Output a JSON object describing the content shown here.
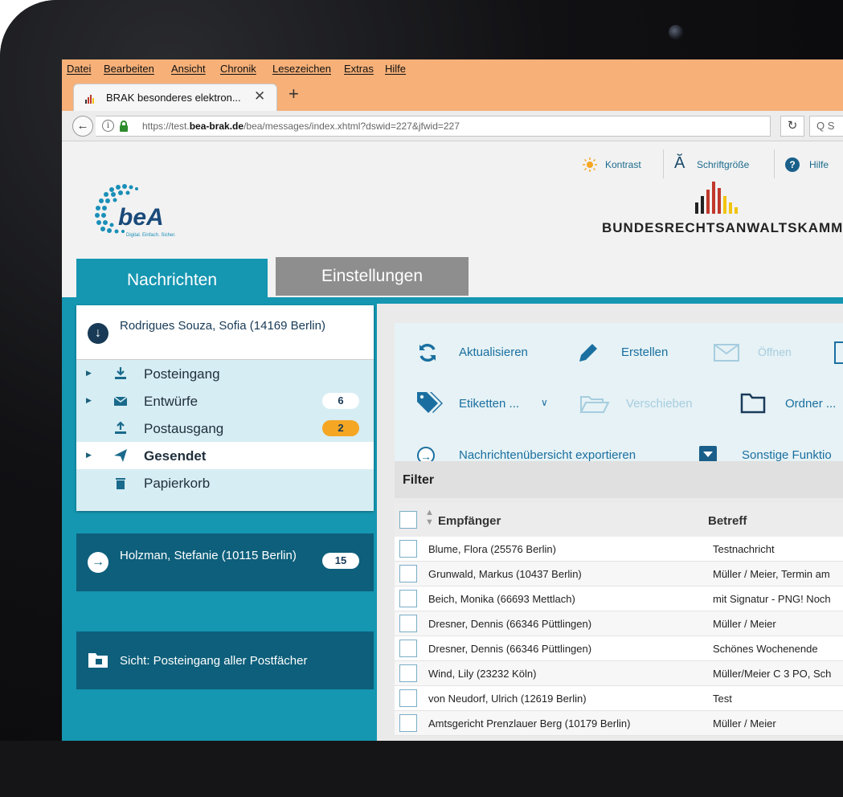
{
  "browser": {
    "menu": [
      "Datei",
      "Bearbeiten",
      "Ansicht",
      "Chronik",
      "Lesezeichen",
      "Extras",
      "Hilfe"
    ],
    "tab_title": "BRAK besonderes elektron...",
    "tab_close": "✕",
    "new_tab": "+",
    "url_prefix": "https://test.",
    "url_domain": "bea-brak.de",
    "url_path": "/bea/messages/index.xhtml?dswid=227&jfwid=227",
    "search_placeholder": "Q S"
  },
  "header": {
    "kontrast": "Kontrast",
    "schriftgroesse": "Schriftgröße",
    "hilfe": "Hilfe",
    "org_name": "BUNDESRECHTSANWALTSKAMMER",
    "logo_text": "beA",
    "logo_tagline": "Digital. Einfach. Sicher."
  },
  "tabs": {
    "nachrichten": "Nachrichten",
    "einstellungen": "Einstellungen"
  },
  "accounts": [
    {
      "name": "Rodrigues Souza, Sofia (14169 Berlin)",
      "folders": [
        {
          "label": "Posteingang",
          "badge": "",
          "icon": "inbox-download-icon",
          "active": false
        },
        {
          "label": "Entwürfe",
          "badge": "6",
          "icon": "envelope-icon",
          "active": false
        },
        {
          "label": "Postausgang",
          "badge": "2",
          "icon": "outbox-upload-icon",
          "active": false
        },
        {
          "label": "Gesendet",
          "badge": "",
          "icon": "paper-plane-icon",
          "active": true
        },
        {
          "label": "Papierkorb",
          "badge": "",
          "icon": "trash-icon",
          "active": false
        }
      ]
    },
    {
      "name": "Holzman, Stefanie (10115 Berlin)",
      "badge": "15"
    }
  ],
  "view": {
    "label": "Sicht: Posteingang aller Postfächer"
  },
  "toolbar": {
    "aktualisieren": "Aktualisieren",
    "erstellen": "Erstellen",
    "oeffnen": "Öffnen",
    "etiketten": "Etiketten ...",
    "verschieben": "Verschieben",
    "ordner": "Ordner ...",
    "exportieren": "Nachrichtenübersicht exportieren",
    "sonstige": "Sonstige Funktio"
  },
  "filter": {
    "label": "Filter"
  },
  "table": {
    "headers": {
      "recipient": "Empfänger",
      "subject": "Betreff"
    },
    "rows": [
      {
        "recipient": "Blume, Flora (25576 Berlin)",
        "subject": "Testnachricht"
      },
      {
        "recipient": "Grunwald, Markus (10437 Berlin)",
        "subject": "Müller / Meier, Termin am"
      },
      {
        "recipient": "Beich, Monika (66693 Mettlach)",
        "subject": "mit Signatur - PNG! Noch"
      },
      {
        "recipient": "Dresner, Dennis (66346 Püttlingen)",
        "subject": "Müller / Meier"
      },
      {
        "recipient": "Dresner, Dennis (66346 Püttlingen)",
        "subject": "Schönes Wochenende"
      },
      {
        "recipient": "Wind, Lily (23232 Köln)",
        "subject": "Müller/Meier C 3 PO, Sch"
      },
      {
        "recipient": "von Neudorf, Ulrich (12619 Berlin)",
        "subject": "Test"
      },
      {
        "recipient": "Amtsgericht Prenzlauer Berg (10179 Berlin)",
        "subject": "Müller / Meier"
      }
    ]
  },
  "colors": {
    "teal": "#1596b1",
    "navy": "#183a56",
    "orange_chrome": "#f6b078",
    "badge_orange": "#f5a623"
  }
}
